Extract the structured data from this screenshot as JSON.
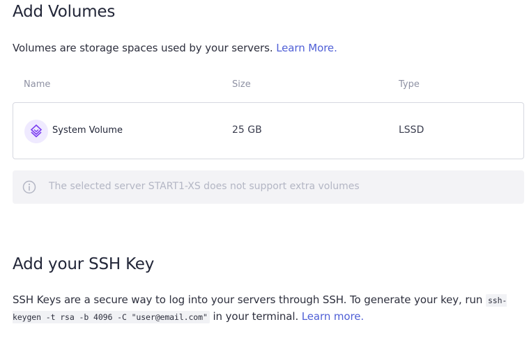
{
  "volumes": {
    "title": "Add Volumes",
    "description": "Volumes are storage spaces used by your servers.",
    "learn_more": "Learn More.",
    "columns": {
      "name": "Name",
      "size": "Size",
      "type": "Type"
    },
    "rows": [
      {
        "name": "System Volume",
        "size": "25 GB",
        "type": "LSSD",
        "icon": "volume-stack-icon"
      }
    ],
    "notice": {
      "icon": "info-icon",
      "text": "The selected server START1-XS does not support extra volumes"
    }
  },
  "ssh": {
    "title": "Add your SSH Key",
    "description_before": "SSH Keys are a secure way to log into your servers through SSH. To generate your key, run ",
    "command": "ssh-keygen -t rsa -b 4096 -C \"user@email.com\"",
    "description_after": " in your terminal.",
    "learn_more": "Learn more."
  },
  "colors": {
    "link": "#4f5fd6",
    "icon_bg": "#efeaff",
    "icon_accent": "#7a3df0",
    "notice_bg": "#f3f3f6"
  }
}
